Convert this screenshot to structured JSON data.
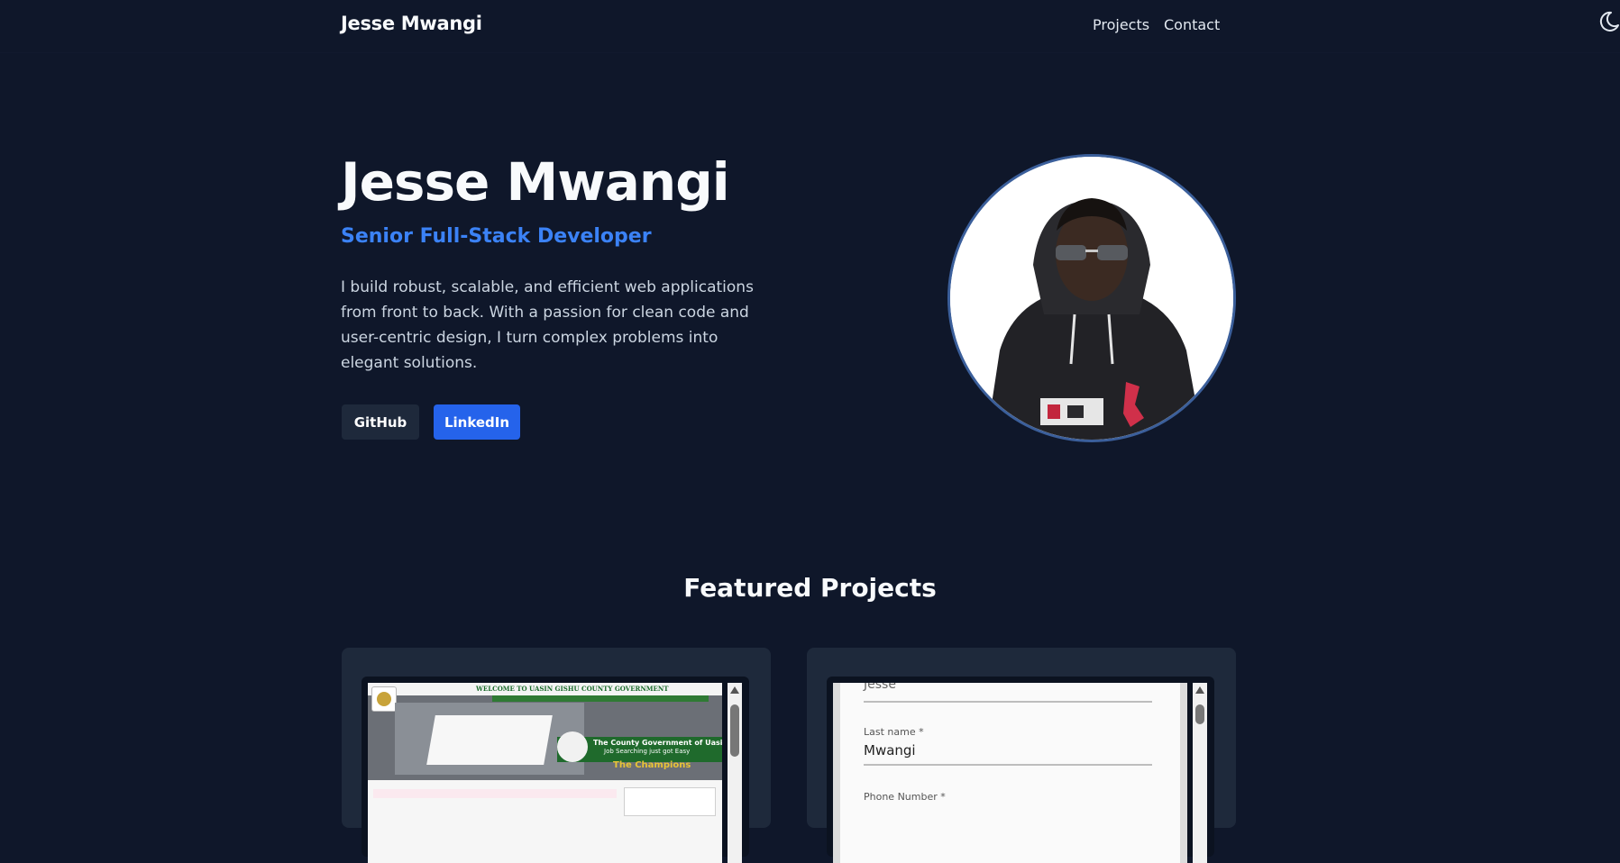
{
  "nav": {
    "brand": "Jesse Mwangi",
    "links": [
      "Projects",
      "Contact"
    ],
    "theme_icon": "moon-icon"
  },
  "hero": {
    "name": "Jesse Mwangi",
    "role": "Senior Full-Stack Developer",
    "bio": "I build robust, scalable, and efficient web applications from front to back. With a passion for clean code and user-centric design, I turn complex problems into elegant solutions.",
    "buttons": {
      "github": "GitHub",
      "linkedin": "LinkedIn"
    }
  },
  "projects": {
    "title": "Featured Projects",
    "card1": {
      "site_title": "WELCOME TO UASIN GISHU COUNTY GOVERNMENT",
      "banner_line1": "The County Government of Uasin Gishu",
      "banner_line2": "Job Searching just got Easy",
      "banner_line3": "The Champions"
    },
    "card2": {
      "prev_value": "Jesse",
      "last_name_label": "Last name *",
      "last_name_value": "Mwangi",
      "phone_label": "Phone Number *"
    }
  },
  "colors": {
    "background": "#0f172a",
    "accent": "#3b82f6",
    "linkedin_button": "#2563eb",
    "card": "#1e293b"
  }
}
